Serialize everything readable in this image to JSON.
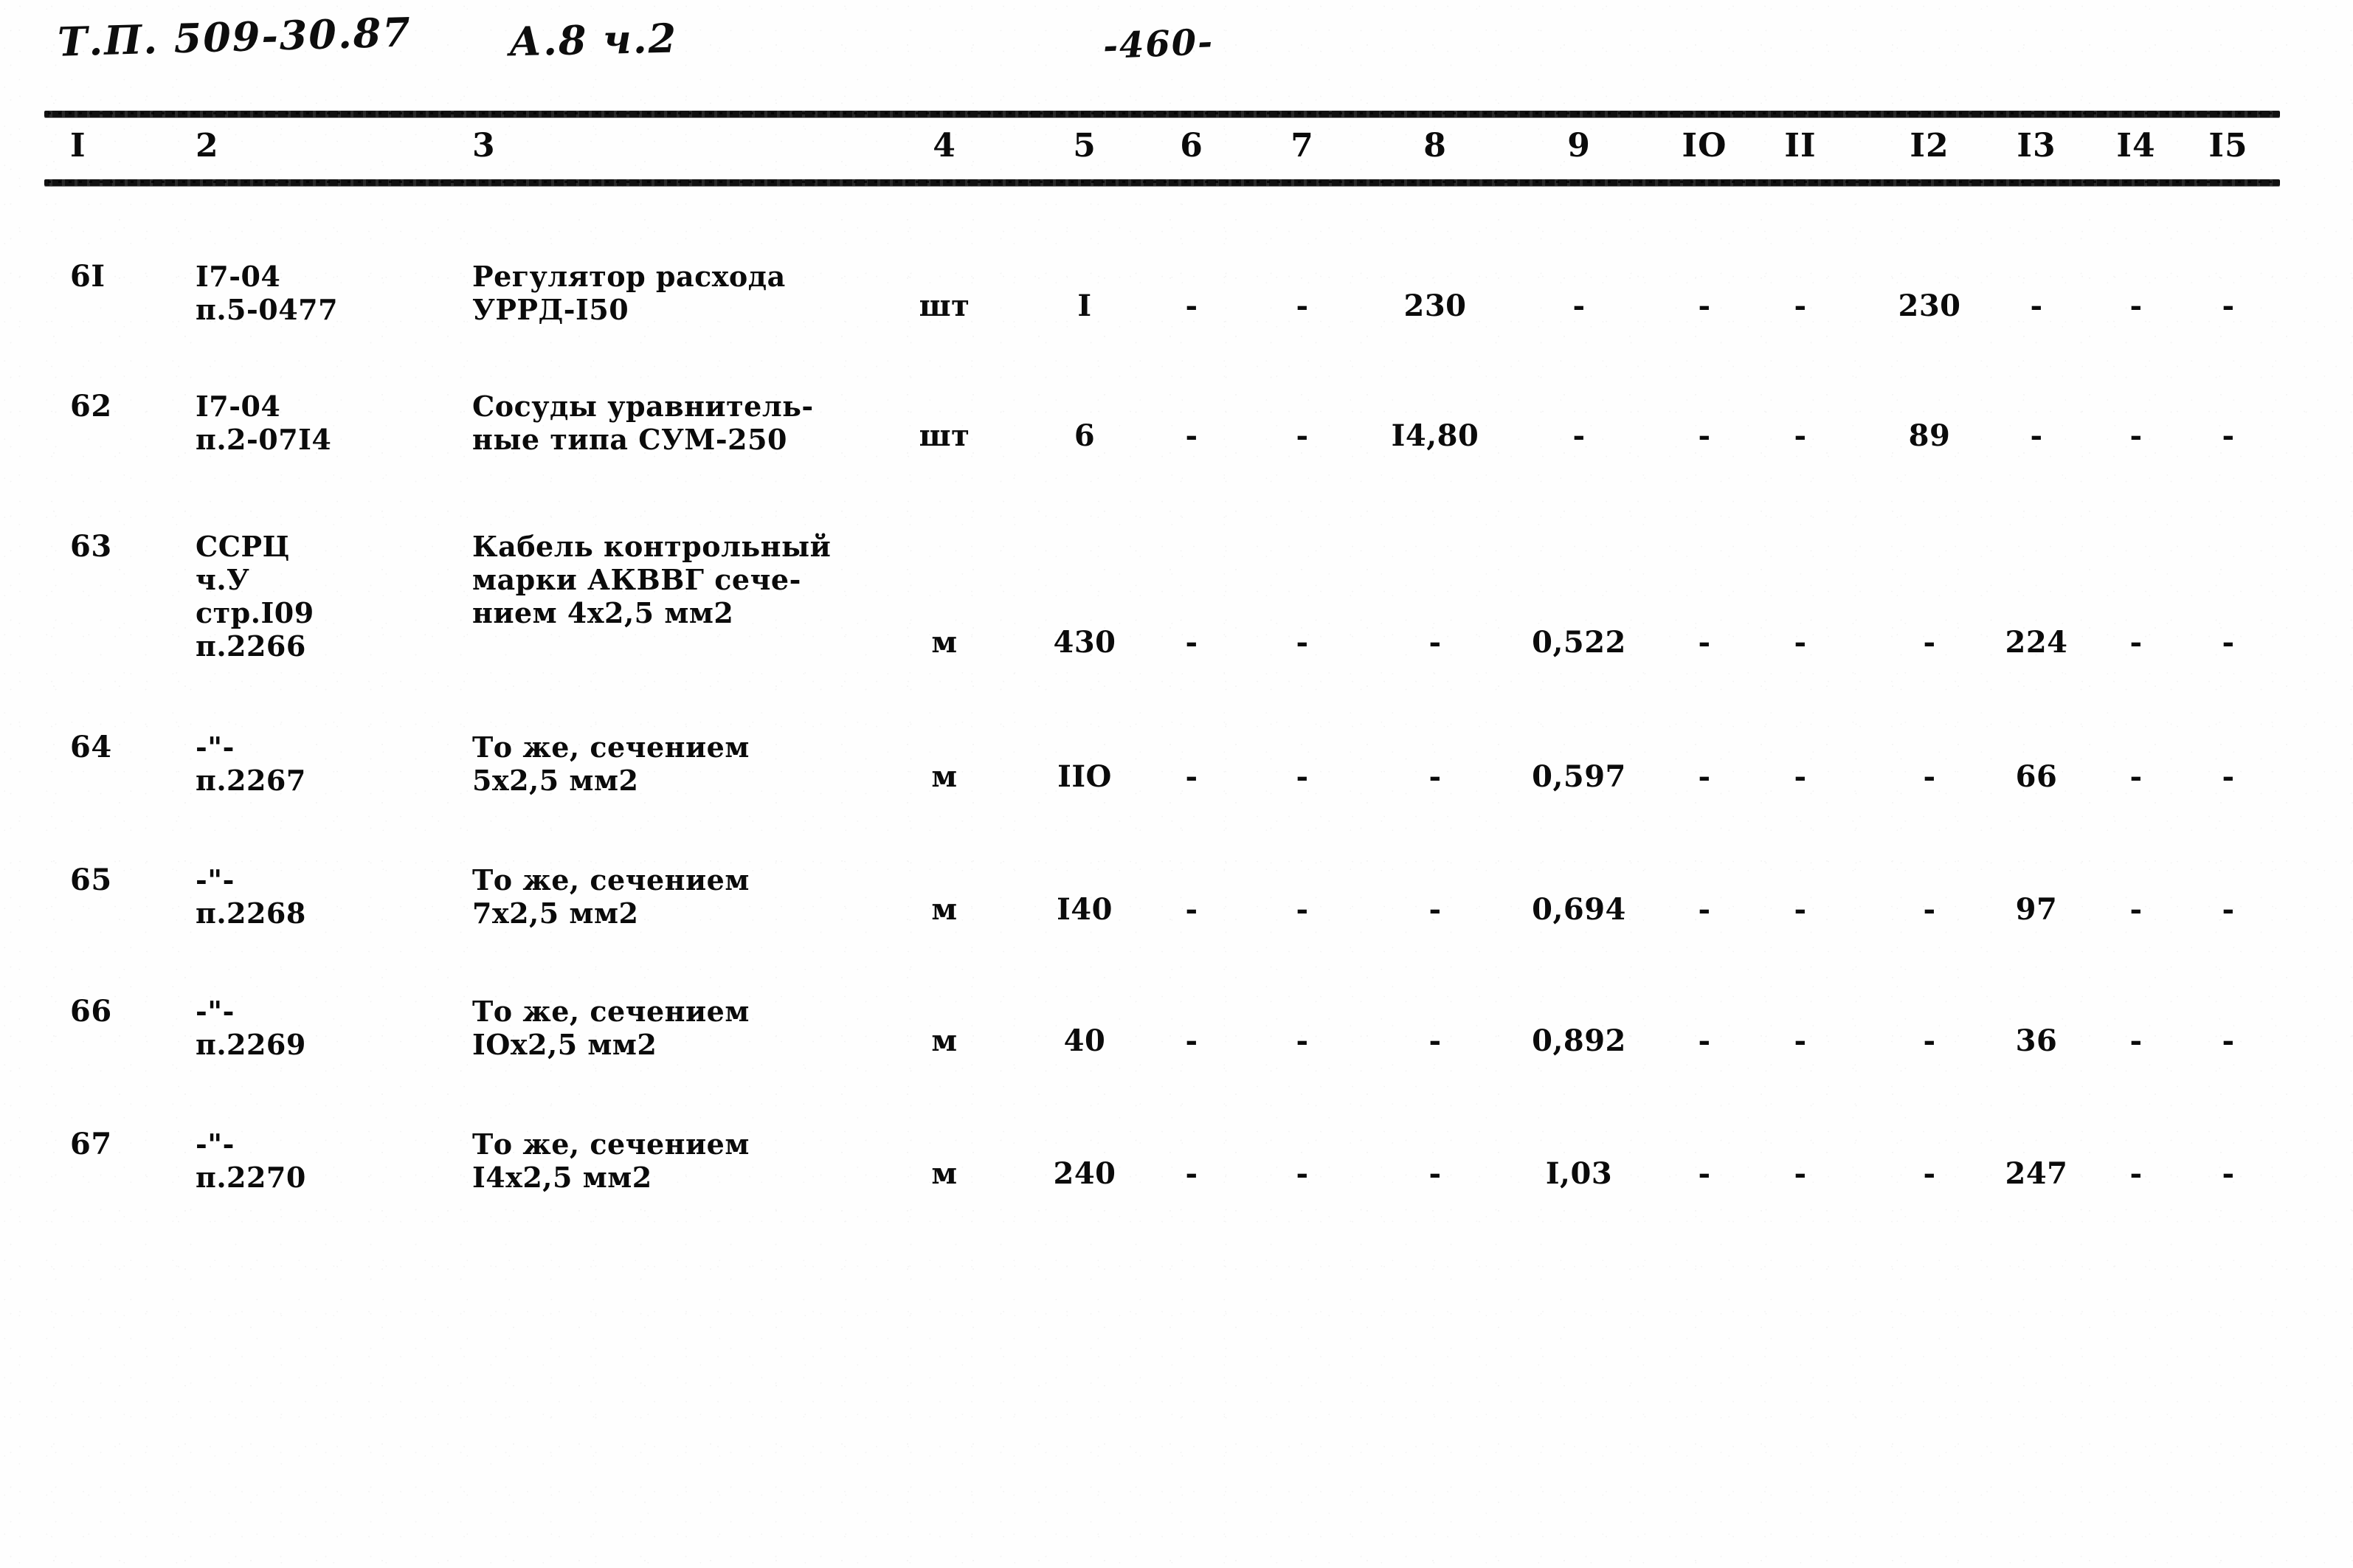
{
  "header": {
    "document_code": "Т.П. 509-30.87",
    "album": "А.8 ч.2",
    "page_number": "-460-"
  },
  "table": {
    "column_headers": [
      "I",
      "2",
      "3",
      "4",
      "5",
      "6",
      "7",
      "8",
      "9",
      "IO",
      "II",
      "I2",
      "I3",
      "I4",
      "I5"
    ],
    "dash": "-",
    "rows": [
      {
        "n": "6I",
        "ref": "I7-04\nп.5-0477",
        "name": "Регулятор расхода\nУРРД-I50",
        "unit": "шт",
        "c5": "I",
        "c6": "-",
        "c7": "-",
        "c8": "230",
        "c9": "-",
        "c10": "-",
        "c11": "-",
        "c12": "230",
        "c13": "-",
        "c14": "-",
        "c15": "-"
      },
      {
        "n": "62",
        "ref": "I7-04\nп.2-07I4",
        "name": "Сосуды уравнитель-\nные типа СУМ-250",
        "unit": "шт",
        "c5": "6",
        "c6": "-",
        "c7": "-",
        "c8": "I4,80",
        "c9": "-",
        "c10": "-",
        "c11": "-",
        "c12": "89",
        "c13": "-",
        "c14": "-",
        "c15": "-"
      },
      {
        "n": "63",
        "ref": "ССРЦ\nч.У\nстр.I09\nп.2266",
        "name": "Кабель контрольный\nмарки АКВВГ сече-\nнием 4х2,5 мм2",
        "unit": "м",
        "c5": "430",
        "c6": "-",
        "c7": "-",
        "c8": "-",
        "c9": "0,522",
        "c10": "-",
        "c11": "-",
        "c12": "-",
        "c13": "224",
        "c14": "-",
        "c15": "-"
      },
      {
        "n": "64",
        "ref": "-\"-\nп.2267",
        "name": "То же, сечением\n5х2,5 мм2",
        "unit": "м",
        "c5": "IIO",
        "c6": "-",
        "c7": "-",
        "c8": "-",
        "c9": "0,597",
        "c10": "-",
        "c11": "-",
        "c12": "-",
        "c13": "66",
        "c14": "-",
        "c15": "-"
      },
      {
        "n": "65",
        "ref": "-\"-\nп.2268",
        "name": "То же, сечением\n7х2,5 мм2",
        "unit": "м",
        "c5": "I40",
        "c6": "-",
        "c7": "-",
        "c8": "-",
        "c9": "0,694",
        "c10": "-",
        "c11": "-",
        "c12": "-",
        "c13": "97",
        "c14": "-",
        "c15": "-"
      },
      {
        "n": "66",
        "ref": "-\"-\nп.2269",
        "name": "То же, сечением\nIОх2,5 мм2",
        "unit": "м",
        "c5": "40",
        "c6": "-",
        "c7": "-",
        "c8": "-",
        "c9": "0,892",
        "c10": "-",
        "c11": "-",
        "c12": "-",
        "c13": "36",
        "c14": "-",
        "c15": "-"
      },
      {
        "n": "67",
        "ref": "-\"-\nп.2270",
        "name": "То же, сечением\nI4х2,5 мм2",
        "unit": "м",
        "c5": "240",
        "c6": "-",
        "c7": "-",
        "c8": "-",
        "c9": "I,03",
        "c10": "-",
        "c11": "-",
        "c12": "-",
        "c13": "247",
        "c14": "-",
        "c15": "-"
      }
    ]
  }
}
